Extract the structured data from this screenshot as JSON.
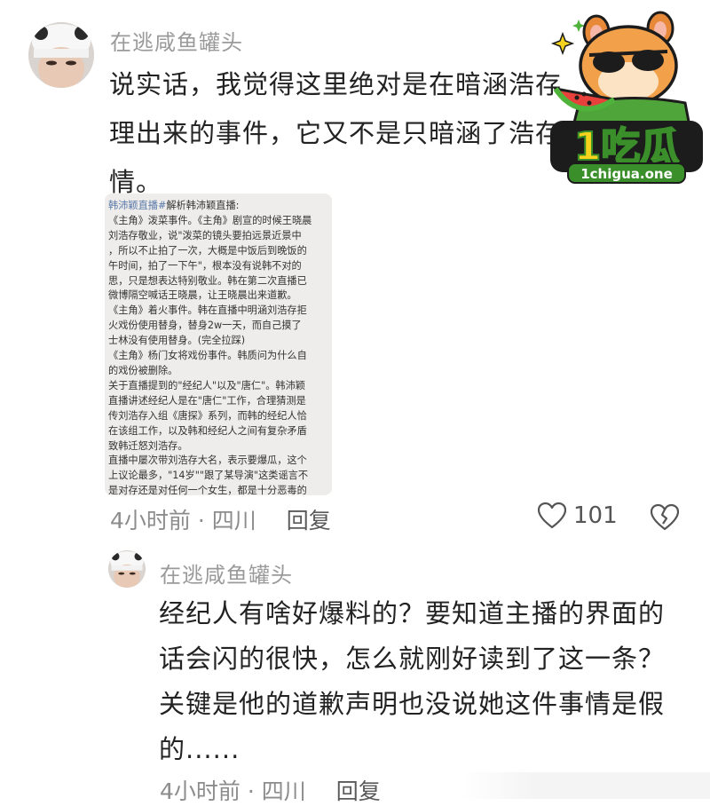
{
  "watermark": {
    "brand": "1吃瓜",
    "url": "1chigua.one"
  },
  "comment1": {
    "username": "在逃咸鱼罐头",
    "text": "说实话，我觉得这里绝对是在暗涵浩存\n理出来的事件，它又不是只暗涵了浩存\n情。",
    "meta_time": "4小时前 · 四川",
    "reply_label": "回复",
    "like_count": "101",
    "screenshot_lines": [
      {
        "tag": "韩沛颖直播#",
        "text": "解析韩沛颖直播:"
      },
      {
        "tag": "",
        "text": "《主角》泼菜事件。《主角》剧宣的时候王晓晨"
      },
      {
        "tag": "",
        "text": "刘浩存敬业，说\"泼菜的镜头要拍远景近景中"
      },
      {
        "tag": "",
        "text": "，所以不止拍了一次，大概是中饭后到晚饭的"
      },
      {
        "tag": "",
        "text": "午时间，拍了一下午\"，根本没有说韩不对的"
      },
      {
        "tag": "",
        "text": "思，只是想表达特别敬业。韩在第二次直播已"
      },
      {
        "tag": "",
        "text": "微博隔空喊话王晓晨，让王晓晨出来道歉。"
      },
      {
        "tag": "",
        "text": "《主角》着火事件。韩在直播中明涵刘浩存拒"
      },
      {
        "tag": "",
        "text": "火戏份使用替身，替身2w一天，而自己摸了"
      },
      {
        "tag": "",
        "text": "士林没有使用替身。(完全拉踩)"
      },
      {
        "tag": "",
        "text": "《主角》杨门女将戏份事件。韩质问为什么自"
      },
      {
        "tag": "",
        "text": "的戏份被删除。"
      },
      {
        "tag": "",
        "text": "关于直播提到的\"经纪人\"以及\"唐仁\"。韩沛颖"
      },
      {
        "tag": "",
        "text": "直播讲述经纪人是在\"唐仁\"工作，合理猜测是"
      },
      {
        "tag": "",
        "text": "传刘浩存入组《唐探》系列，而韩的经纪人恰"
      },
      {
        "tag": "",
        "text": "在该组工作，以及韩和经纪人之间有复杂矛盾"
      },
      {
        "tag": "",
        "text": "致韩迁怒刘浩存。"
      },
      {
        "tag": "",
        "text": "直播中屡次带刘浩存大名，表示要爆瓜，这个"
      },
      {
        "tag": "",
        "text": "上议论最多，\"14岁\"\"跟了某导演\"这类谣言不"
      },
      {
        "tag": "",
        "text": "是对存还是对任何一个女生，都是十分恶毒的"
      }
    ]
  },
  "comment2": {
    "username": "在逃咸鱼罐头",
    "text": "经纪人有啥好爆料的？要知道主播的界面的\n话会闪的很快，怎么就刚好读到了这一条？\n关键是他的道歉声明也没说她这件事情是假\n的......",
    "meta_time": "4小时前 · 四川",
    "reply_label": "回复"
  },
  "colors": {
    "username": "#9a9a9a",
    "text": "#222222",
    "meta": "#8c8c8c",
    "brand_green": "#3a8f2a",
    "brand_yellow": "#f5d21c"
  }
}
